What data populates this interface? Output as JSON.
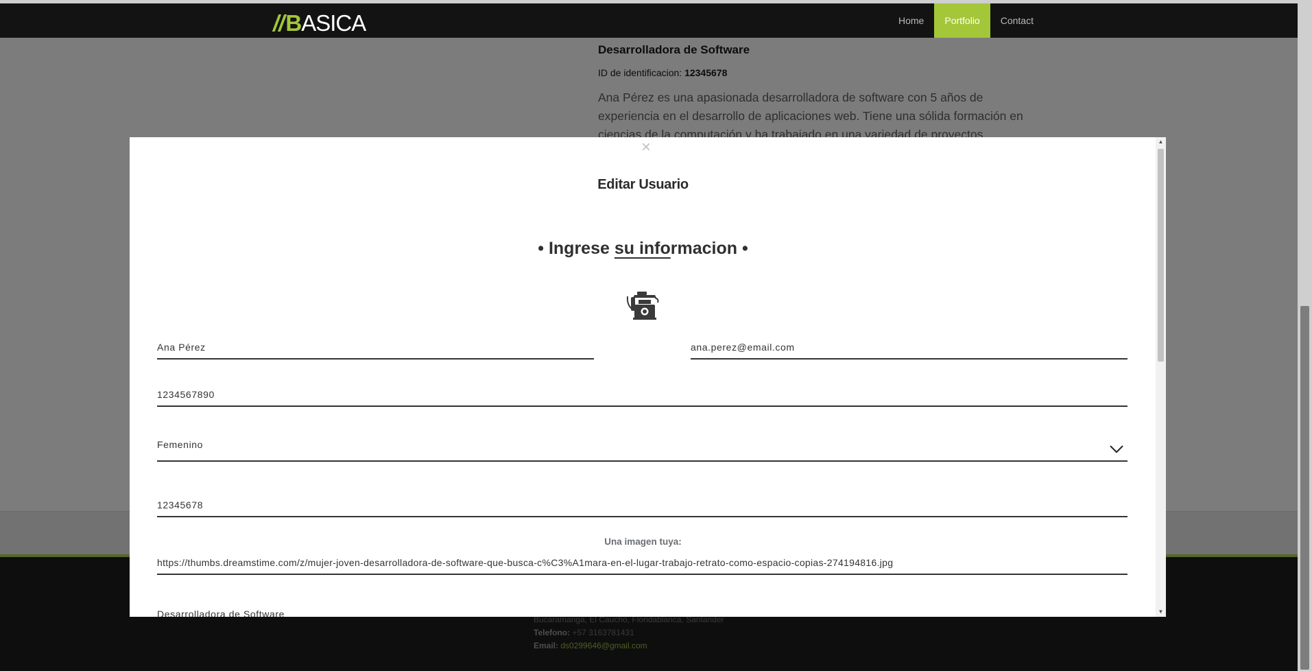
{
  "navbar": {
    "logo_slashes": "//",
    "logo_b": "B",
    "logo_rest": "ASICA",
    "links": [
      "Home",
      "Portfolio",
      "Contact"
    ],
    "active": "Portfolio",
    "accent_color": "#a4c639"
  },
  "background": {
    "job_title": "Desarrolladora de Software",
    "id_label": "ID de identificacion:",
    "id_value": "12345678",
    "description": "Ana Pérez es una apasionada desarrolladora de software con 5 años de experiencia en el desarrollo de aplicaciones web. Tiene una sólida formación en ciencias de la computación y ha trabajado en una variedad de proyectos"
  },
  "footer": {
    "address": "Bucaramanga, El Caucho, Floridablanca, Santander",
    "phone_label": "Telefono:",
    "phone_value": "+57 3163781431",
    "email_label": "Email:",
    "email_value": "ds0299646@gmail.com"
  },
  "modal": {
    "close_glyph": "×",
    "title": "Editar Usuario",
    "heading_prefix": "• Ingrese ",
    "heading_underlined": "su info",
    "heading_suffix": "rmacion •",
    "icon": "telephone-icon",
    "fields": {
      "name": "Ana Pérez",
      "email": "ana.perez@email.com",
      "phone": "1234567890",
      "gender": "Femenino",
      "id": "12345678",
      "image_label": "Una imagen tuya:",
      "image_url": "https://thumbs.dreamstime.com/z/mujer-joven-desarrolladora-de-software-que-busca-c%C3%A1mara-en-el-lugar-trabajo-retrato-como-espacio-copias-274194816.jpg",
      "role": "Desarrolladora de Software"
    }
  }
}
